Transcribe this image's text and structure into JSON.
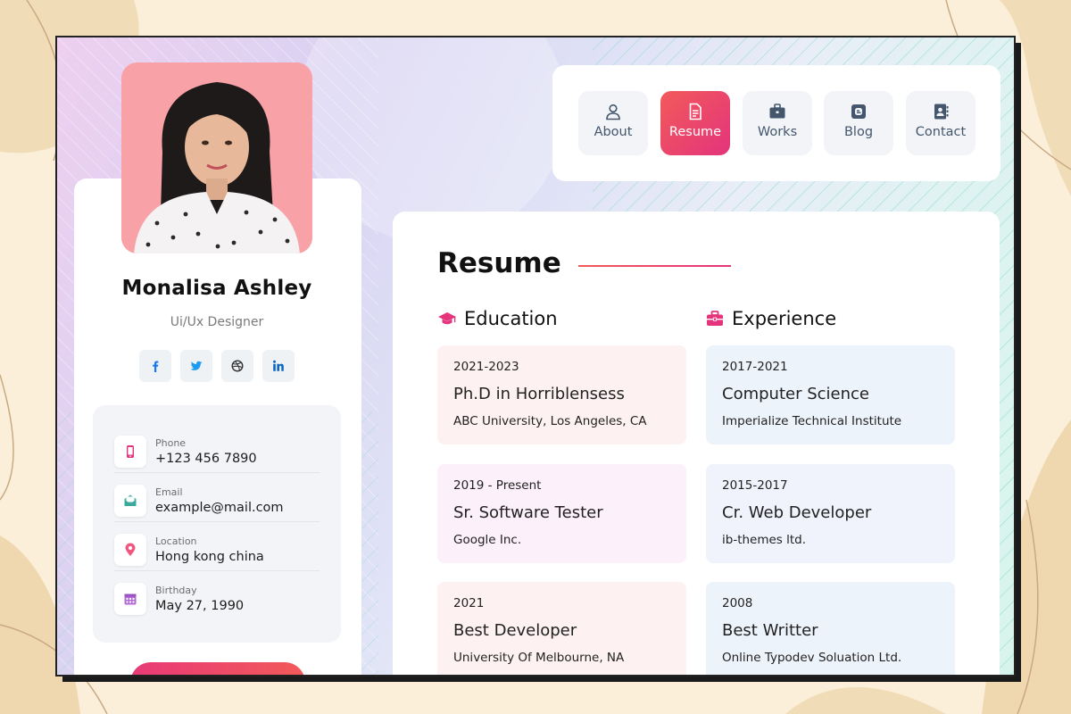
{
  "profile": {
    "name": "Monalisa Ashley",
    "role": "Ui/Ux Designer",
    "socials": [
      "facebook-icon",
      "twitter-icon",
      "dribbble-icon",
      "linkedin-icon"
    ],
    "info": [
      {
        "label": "Phone",
        "value": "+123 456 7890",
        "icon": "phone-icon",
        "color": "#e3347c"
      },
      {
        "label": "Email",
        "value": "example@mail.com",
        "icon": "mail-icon",
        "color": "#4db6ac"
      },
      {
        "label": "Location",
        "value": "Hong kong china",
        "icon": "location-icon",
        "color": "#f0577f"
      },
      {
        "label": "Birthday",
        "value": "May 27, 1990",
        "icon": "calendar-icon",
        "color": "#b26bd6"
      }
    ]
  },
  "nav": {
    "items": [
      {
        "label": "About",
        "icon": "user-icon",
        "active": false
      },
      {
        "label": "Resume",
        "icon": "file-icon",
        "active": true
      },
      {
        "label": "Works",
        "icon": "briefcase-icon",
        "active": false
      },
      {
        "label": "Blog",
        "icon": "blog-icon",
        "active": false
      },
      {
        "label": "Contact",
        "icon": "contact-book-icon",
        "active": false
      }
    ]
  },
  "resume": {
    "title": "Resume",
    "education": {
      "heading": "Education",
      "entries": [
        {
          "date": "2021-2023",
          "title": "Ph.D in Horriblensess",
          "subtitle": "ABC University, Los Angeles, CA"
        },
        {
          "date": "2019 - Present",
          "title": "Sr. Software Tester",
          "subtitle": "Google Inc."
        },
        {
          "date": "2021",
          "title": "Best Developer",
          "subtitle": "University Of Melbourne, NA"
        }
      ]
    },
    "experience": {
      "heading": "Experience",
      "entries": [
        {
          "date": "2017-2021",
          "title": "Computer Science",
          "subtitle": "Imperialize Technical Institute"
        },
        {
          "date": "2015-2017",
          "title": "Cr. Web Developer",
          "subtitle": "ib-themes ltd."
        },
        {
          "date": "2008",
          "title": "Best Writter",
          "subtitle": "Online Typodev Soluation Ltd."
        }
      ]
    }
  },
  "colors": {
    "accent": "#e3347c",
    "accent_alt": "#f25a5a",
    "education_card_bg": [
      "#fdf1f2",
      "#fcf0fa",
      "#fdf1f2"
    ],
    "experience_card_bg": [
      "#edf3fa",
      "#f0f3fc",
      "#edf3fa"
    ]
  }
}
